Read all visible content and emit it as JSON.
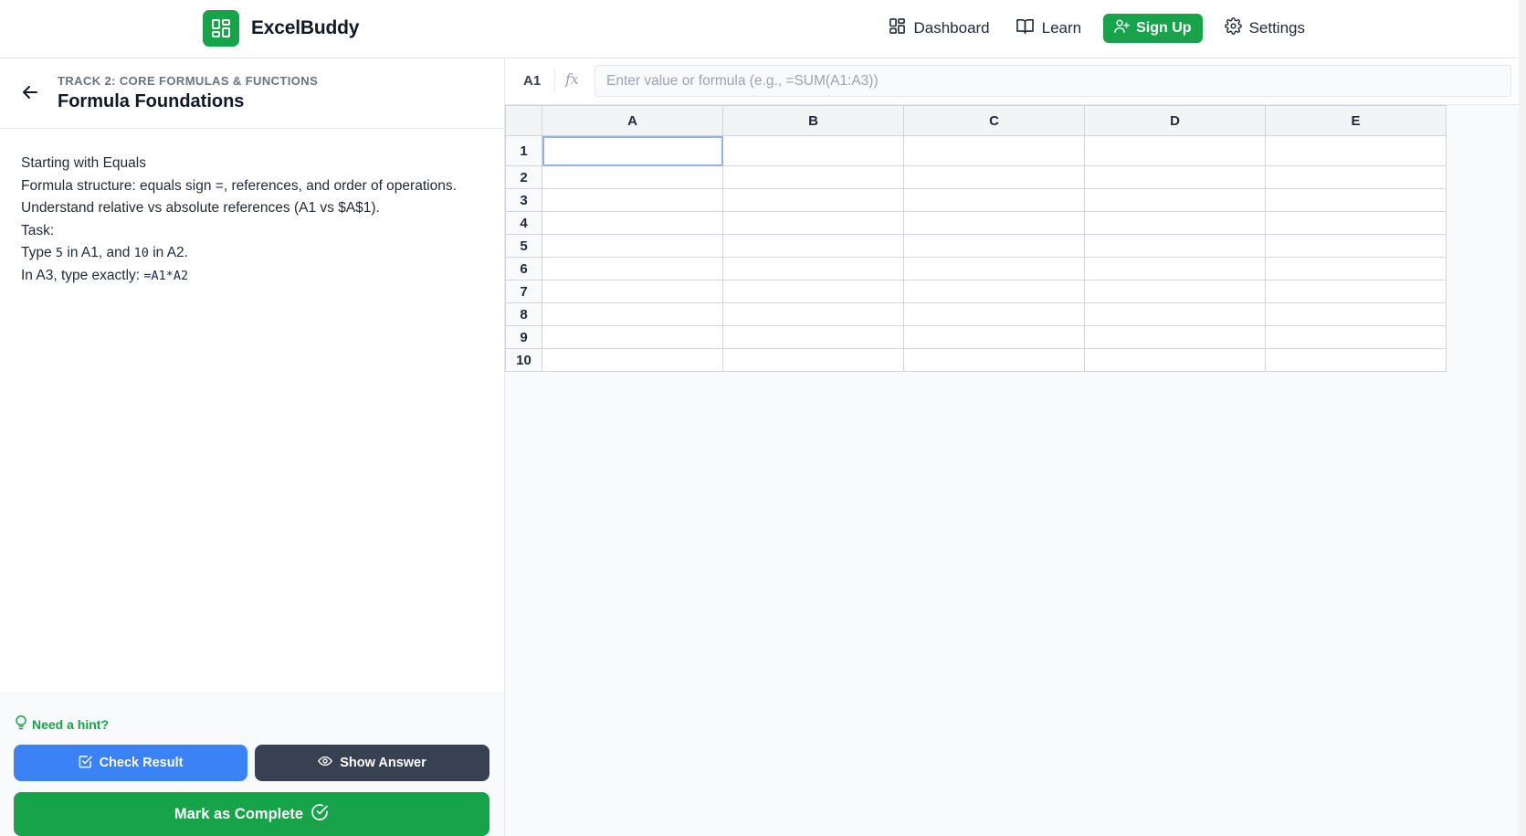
{
  "brand": {
    "name": "ExcelBuddy"
  },
  "nav": {
    "dashboard": "Dashboard",
    "learn": "Learn",
    "signup": "Sign Up",
    "settings": "Settings"
  },
  "lesson": {
    "track": "TRACK 2: CORE FORMULAS & FUNCTIONS",
    "title": "Formula Foundations",
    "lines": {
      "l1": "Starting with Equals",
      "l2": "Formula structure: equals sign =, references, and order of operations.",
      "l3": "Understand relative vs absolute references (A1 vs $A$1).",
      "l4": "Task:",
      "l5a": "Type ",
      "l5b": "5",
      "l5c": " in A1, and ",
      "l5d": "10",
      "l5e": " in A2.",
      "l6a": "In A3, type exactly: ",
      "l6b": "=A1*A2"
    }
  },
  "actions": {
    "hint": "Need a hint?",
    "check": "Check Result",
    "answer": "Show Answer",
    "complete": "Mark as Complete"
  },
  "formula_bar": {
    "cell_ref": "A1",
    "fx": "fx",
    "placeholder": "Enter value or formula (e.g., =SUM(A1:A3))",
    "value": ""
  },
  "sheet": {
    "columns": [
      "A",
      "B",
      "C",
      "D",
      "E"
    ],
    "rows": [
      "1",
      "2",
      "3",
      "4",
      "5",
      "6",
      "7",
      "8",
      "9",
      "10"
    ],
    "active_cell": "A1"
  },
  "colors": {
    "brand_green": "#16a34a",
    "check_blue": "#3b82f6",
    "answer_dark": "#374151"
  }
}
